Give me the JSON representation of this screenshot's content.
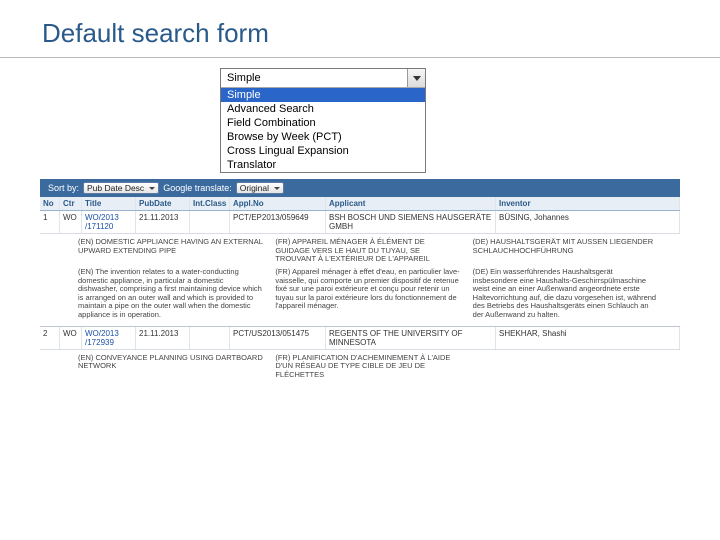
{
  "title": "Default search form",
  "search_mode": {
    "selected": "Simple",
    "options": [
      "Simple",
      "Advanced Search",
      "Field Combination",
      "Browse by Week (PCT)",
      "Cross Lingual Expansion",
      "Translator"
    ]
  },
  "toolbar": {
    "sort_label": "Sort by:",
    "sort_value": "Pub Date Desc",
    "translate_label": "Google translate:",
    "translate_value": "Original"
  },
  "columns": [
    "No",
    "Ctr",
    "Title",
    "PubDate",
    "Int.Class",
    "Appl.No",
    "Applicant",
    "Inventor"
  ],
  "rows": [
    {
      "no": "1",
      "ctr": "WO",
      "title": "WO/2013\n/171120",
      "pubdate": "21.11.2013",
      "intclass": "",
      "applno": "PCT/EP2013/059649",
      "applicant": "BSH BOSCH UND SIEMENS HAUSGERÄTE GMBH",
      "inventor": "BÜSING, Johannes",
      "titles": {
        "en": "(EN) DOMESTIC APPLIANCE HAVING AN EXTERNAL UPWARD EXTENDING PIPE",
        "fr": "(FR) APPAREIL MÉNAGER À ÉLÉMENT DE GUIDAGE VERS LE HAUT DU TUYAU, SE TROUVANT À L'EXTÉRIEUR DE L'APPAREIL",
        "de": "(DE) HAUSHALTSGERÄT MIT AUSSEN LIEGENDER SCHLAUCHHOCHFÜHRUNG"
      },
      "abstracts": {
        "en": "(EN) The invention relates to a water-conducting domestic appliance, in particular a domestic dishwasher, comprising a first maintaining device which is arranged on an outer wall and which is provided to maintain a pipe on the outer wall when the domestic appliance is in operation.",
        "fr": "(FR) Appareil ménager à effet d'eau, en particulier lave-vaisselle, qui comporte un premier dispositif de retenue fixé sur une paroi extérieure et conçu pour retenir un tuyau sur la paroi extérieure lors du fonctionnement de l'appareil ménager.",
        "de": "(DE) Ein wasserführendes Haushaltsgerät insbesondere eine Haushalts-Geschirrspülmaschine weist eine an einer Außenwand angeordnete erste Haltevorrichtung auf, die dazu vorgesehen ist, während des Betriebs des Haushaltsgeräts einen Schlauch an der Außenwand zu halten."
      }
    },
    {
      "no": "2",
      "ctr": "WO",
      "title": "WO/2013\n/172939",
      "pubdate": "21.11.2013",
      "intclass": "",
      "applno": "PCT/US2013/051475",
      "applicant": "REGENTS OF THE UNIVERSITY OF MINNESOTA",
      "inventor": "SHEKHAR, Shashi",
      "titles": {
        "en": "(EN) CONVEYANCE PLANNING USING DARTBOARD NETWORK",
        "fr": "(FR) PLANIFICATION D'ACHEMINEMENT À L'AIDE D'UN RÉSEAU DE TYPE CIBLE DE JEU DE FLÉCHETTES",
        "de": ""
      }
    }
  ]
}
